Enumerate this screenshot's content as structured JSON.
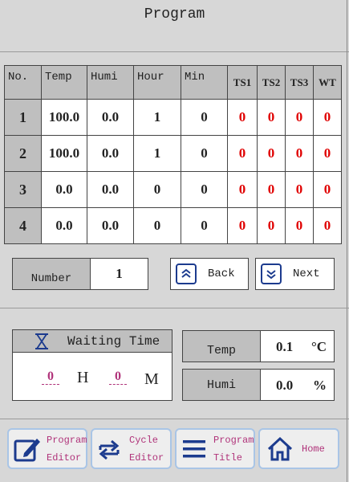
{
  "title": "Program",
  "table": {
    "headers": [
      "No.",
      "Temp",
      "Humi",
      "Hour",
      "Min",
      "TS1",
      "TS2",
      "TS3",
      "WT"
    ],
    "rows": [
      {
        "no": "1",
        "temp": "100.0",
        "humi": "0.0",
        "hour": "1",
        "min": "0",
        "ts1": "0",
        "ts2": "0",
        "ts3": "0",
        "wt": "0"
      },
      {
        "no": "2",
        "temp": "100.0",
        "humi": "0.0",
        "hour": "1",
        "min": "0",
        "ts1": "0",
        "ts2": "0",
        "ts3": "0",
        "wt": "0"
      },
      {
        "no": "3",
        "temp": "0.0",
        "humi": "0.0",
        "hour": "0",
        "min": "0",
        "ts1": "0",
        "ts2": "0",
        "ts3": "0",
        "wt": "0"
      },
      {
        "no": "4",
        "temp": "0.0",
        "humi": "0.0",
        "hour": "0",
        "min": "0",
        "ts1": "0",
        "ts2": "0",
        "ts3": "0",
        "wt": "0"
      }
    ]
  },
  "number": {
    "label": "Number",
    "value": "1"
  },
  "nav": {
    "back": "Back",
    "next": "Next"
  },
  "waiting": {
    "title": "Waiting Time",
    "hours_value": "0",
    "hours_unit": "H",
    "minutes_value": "0",
    "minutes_unit": "M"
  },
  "readout": {
    "temp_label": "Temp",
    "temp_value": "0.1",
    "temp_unit": "°C",
    "humi_label": "Humi",
    "humi_value": "0.0",
    "humi_unit": "%"
  },
  "bottom": {
    "program_editor_l1": "Program",
    "program_editor_l2": "Editor",
    "cycle_editor_l1": "Cycle",
    "cycle_editor_l2": "Editor",
    "program_title_l1": "Program",
    "program_title_l2": "Title",
    "home": "Home"
  },
  "colors": {
    "zero_values": "#e00000",
    "icon": "#1c3b8e",
    "bottom_label": "#b0337a"
  }
}
